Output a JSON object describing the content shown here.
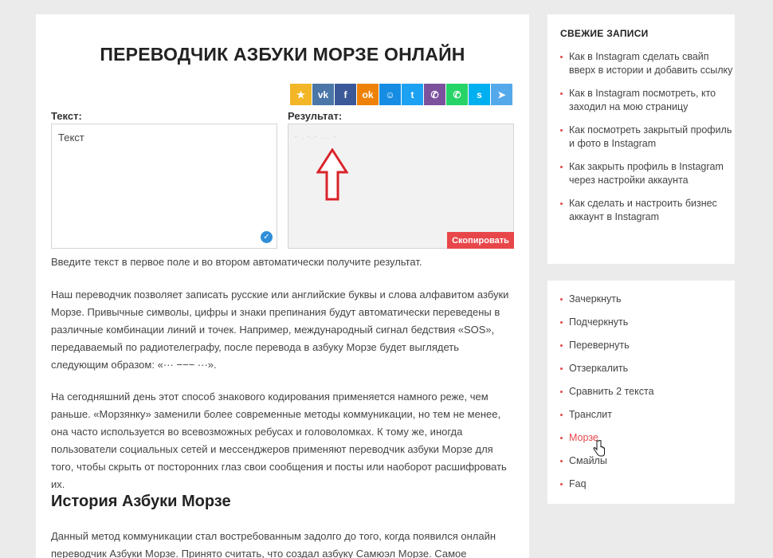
{
  "main": {
    "title": "ПЕРЕВОДЧИК АЗБУКИ МОРЗЕ ОНЛАЙН",
    "share": [
      {
        "icon": "star-icon",
        "glyph": "★",
        "color": "#f2b626"
      },
      {
        "icon": "vk-icon",
        "glyph": "vk",
        "color": "#4a76a8"
      },
      {
        "icon": "facebook-icon",
        "glyph": "f",
        "color": "#3b5998"
      },
      {
        "icon": "odnoklassniki-icon",
        "glyph": "ok",
        "color": "#ee8208"
      },
      {
        "icon": "mailru-icon",
        "glyph": "☺",
        "color": "#168de2"
      },
      {
        "icon": "twitter-icon",
        "glyph": "t",
        "color": "#1da1f2"
      },
      {
        "icon": "viber-icon",
        "glyph": "✆",
        "color": "#7b519d"
      },
      {
        "icon": "whatsapp-icon",
        "glyph": "✆",
        "color": "#25d366"
      },
      {
        "icon": "skype-icon",
        "glyph": "s",
        "color": "#00aff0"
      },
      {
        "icon": "telegram-icon",
        "glyph": "➤",
        "color": "#54a9eb"
      }
    ],
    "input_label": "Текст:",
    "input_placeholder": "Текст",
    "result_label": "Результат:",
    "result_value": "- . -.- ... -",
    "copy_label": "Скопировать",
    "intro": "Введите текст в первое поле и во втором автоматически получите результат.",
    "para1": "Наш переводчик позволяет записать русские или английские буквы и слова алфавитом азбуки Морзе. Привычные символы, цифры и знаки препинания будут автоматически переведены в различные комбинации линий и точек. Например, международный сигнал бедствия «SOS», передаваемый по радиотелеграфу, после перевода в азбуку Морзе будет выглядеть следующим образом: «··· −−− ···».",
    "para2": "На сегодняшний день этот способ знакового кодирования применяется намного реже, чем раньше. «Морзянку» заменили более современные методы коммуникации, но тем не менее, она часто используется во всевозможных ребусах и головоломках. К тому же, иногда пользователи социальных сетей и мессенджеров применяют переводчик азбуки Морзе для того, чтобы скрыть от посторонних глаз свои сообщения и посты или наоборот расшифровать их.",
    "history_heading": "История Азбуки Морзе",
    "para3": "Данный метод коммуникации стал востребованным задолго до того, когда появился онлайн переводчик Азбуки Морзе. Принято считать, что создал азбуку Самюэл Морзе. Самое"
  },
  "sidebar": {
    "recent_heading": "СВЕЖИЕ ЗАПИСИ",
    "recent": [
      "Как в Instagram сделать свайп вверх в истории и добавить ссылку",
      "Как в Instagram посмотреть, кто заходил на мою страницу",
      "Как посмотреть закрытый профиль и фото в Instagram",
      "Как закрыть профиль в Instagram через настройки аккаунта",
      "Как сделать и настроить бизнес аккаунт в Instagram"
    ],
    "tools": [
      "Зачеркнуть",
      "Подчеркнуть",
      "Перевернуть",
      "Отзеркалить",
      "Сравнить 2 текста",
      "Транслит",
      "Морзе",
      "Смайлы",
      "Faq"
    ],
    "active_tool": "Морзе",
    "accent": "#e8474a"
  }
}
